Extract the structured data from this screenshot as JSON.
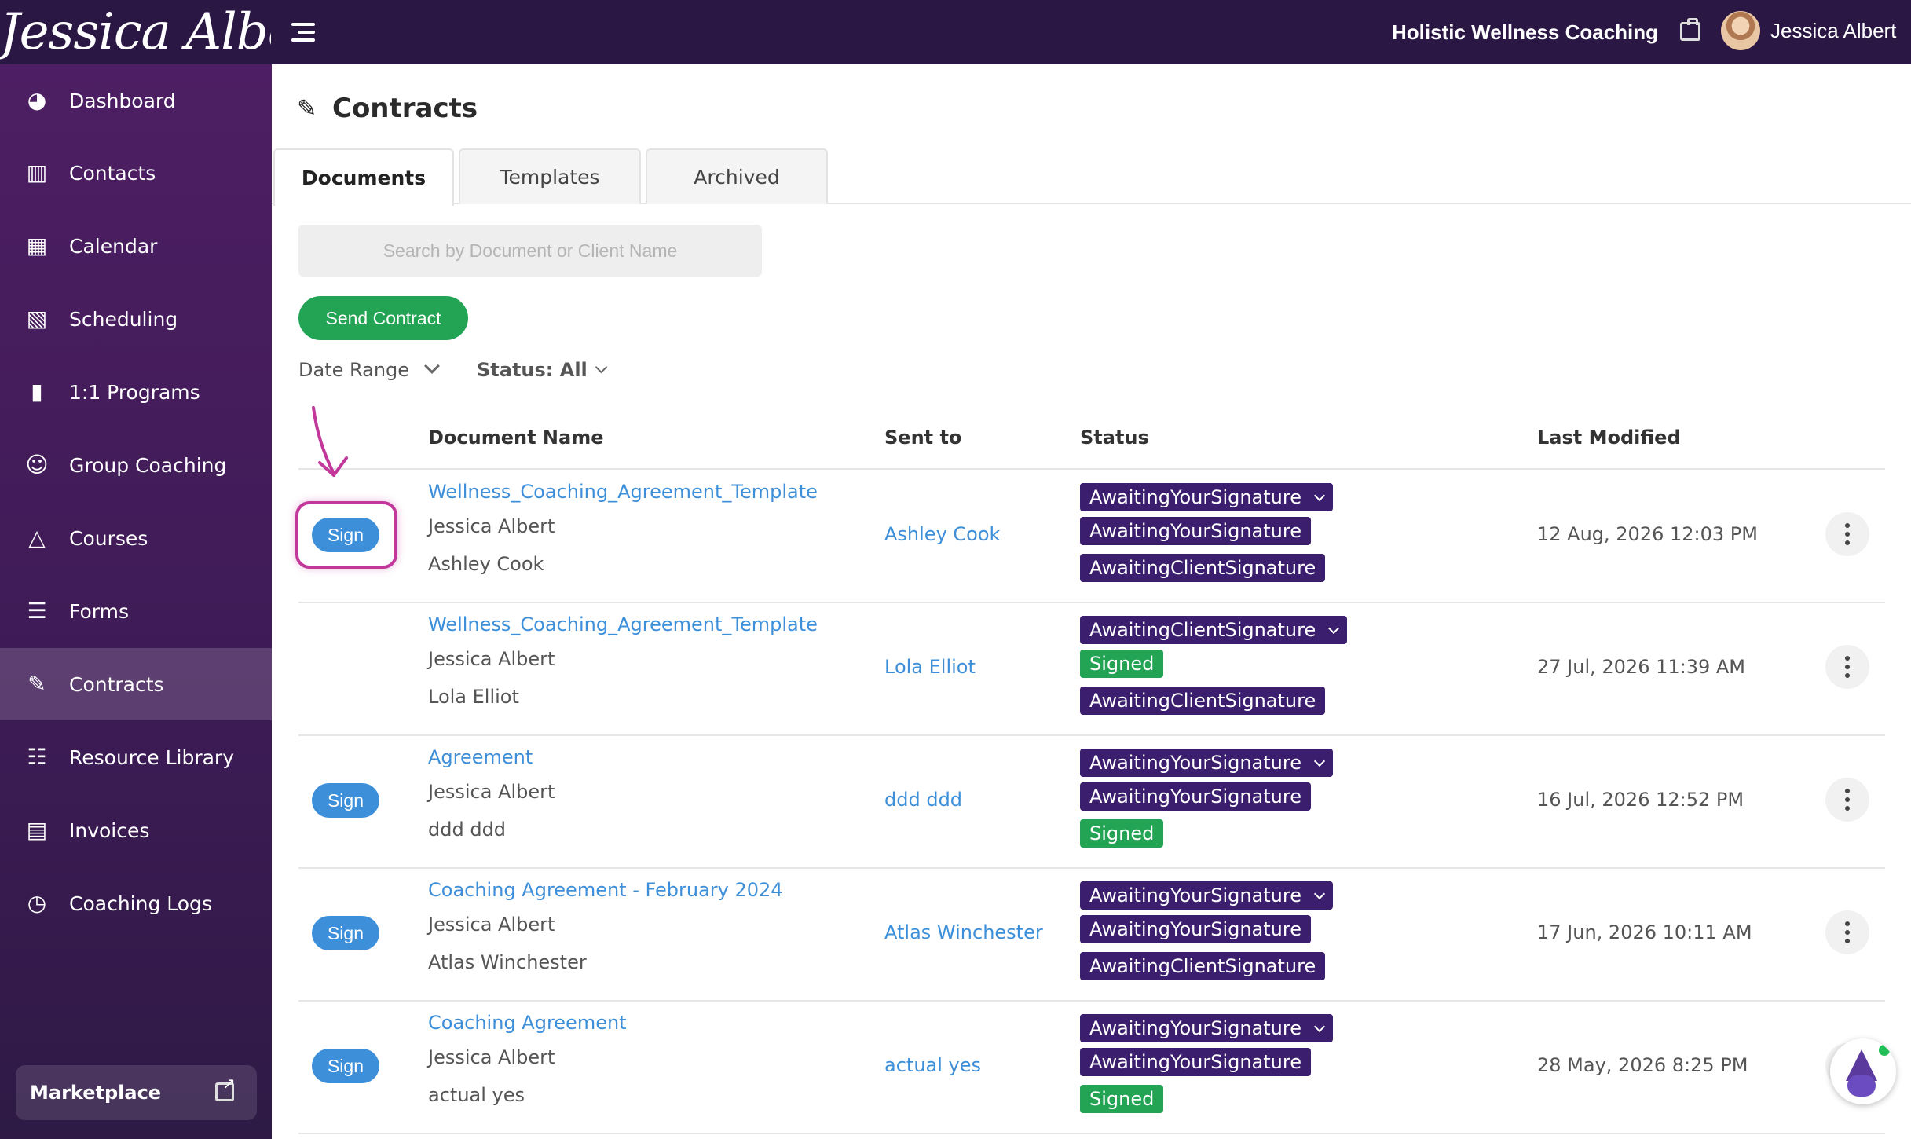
{
  "header": {
    "logo_text": "Jessica Albert",
    "business_name": "Holistic Wellness Coaching",
    "user_name": "Jessica Albert"
  },
  "sidebar": {
    "items": [
      {
        "label": "Dashboard",
        "icon": "dashboard-icon"
      },
      {
        "label": "Contacts",
        "icon": "contacts-icon"
      },
      {
        "label": "Calendar",
        "icon": "calendar-icon"
      },
      {
        "label": "Scheduling",
        "icon": "scheduling-icon"
      },
      {
        "label": "1:1 Programs",
        "icon": "book-icon"
      },
      {
        "label": "Group Coaching",
        "icon": "group-icon"
      },
      {
        "label": "Courses",
        "icon": "graduation-cap-icon"
      },
      {
        "label": "Forms",
        "icon": "list-check-icon"
      },
      {
        "label": "Contracts",
        "icon": "signature-icon",
        "active": true
      },
      {
        "label": "Resource Library",
        "icon": "books-icon"
      },
      {
        "label": "Invoices",
        "icon": "invoice-icon"
      },
      {
        "label": "Coaching Logs",
        "icon": "clock-icon"
      }
    ],
    "marketplace_label": "Marketplace"
  },
  "page": {
    "title": "Contracts",
    "tabs": [
      {
        "label": "Documents",
        "active": true
      },
      {
        "label": "Templates"
      },
      {
        "label": "Archived"
      }
    ],
    "search_placeholder": "Search by Document or Client Name",
    "send_button": "Send Contract",
    "filters": {
      "date_range": "Date Range",
      "status": "Status: All"
    }
  },
  "table": {
    "headers": {
      "document_name": "Document Name",
      "sent_to": "Sent to",
      "status": "Status",
      "last_modified": "Last Modified"
    },
    "sign_label": "Sign",
    "rows": [
      {
        "has_sign": true,
        "document": "Wellness_Coaching_Agreement_Template",
        "sender": "Jessica Albert",
        "recipient": "Ashley Cook",
        "sent_to": "Ashley Cook",
        "statuses": [
          "AwaitingYourSignature",
          "AwaitingYourSignature",
          "AwaitingClientSignature"
        ],
        "modified": "12 Aug, 2026 12:03 PM"
      },
      {
        "has_sign": false,
        "document": "Wellness_Coaching_Agreement_Template",
        "sender": "Jessica Albert",
        "recipient": "Lola Elliot",
        "sent_to": "Lola Elliot",
        "statuses": [
          "AwaitingClientSignature",
          "Signed",
          "AwaitingClientSignature"
        ],
        "modified": "27 Jul, 2026 11:39 AM"
      },
      {
        "has_sign": true,
        "document": "Agreement",
        "sender": "Jessica Albert",
        "recipient": "ddd ddd",
        "sent_to": "ddd ddd",
        "statuses": [
          "AwaitingYourSignature",
          "AwaitingYourSignature",
          "Signed"
        ],
        "modified": "16 Jul, 2026 12:52 PM"
      },
      {
        "has_sign": true,
        "document": "Coaching Agreement - February 2024",
        "sender": "Jessica Albert",
        "recipient": "Atlas Winchester",
        "sent_to": "Atlas Winchester",
        "statuses": [
          "AwaitingYourSignature",
          "AwaitingYourSignature",
          "AwaitingClientSignature"
        ],
        "modified": "17 Jun, 2026 10:11 AM"
      },
      {
        "has_sign": true,
        "document": "Coaching Agreement",
        "sender": "Jessica Albert",
        "recipient": "actual yes",
        "sent_to": "actual yes",
        "statuses": [
          "AwaitingYourSignature",
          "AwaitingYourSignature",
          "Signed"
        ],
        "modified": "28 May, 2026 8:25 PM"
      }
    ]
  },
  "colors": {
    "topbar": "#2a1744",
    "sidebar": "#4d1e63",
    "link_blue": "#3d8fd9",
    "awaiting_badge": "#3b1f6e",
    "signed_badge": "#23a455",
    "send_button": "#23a455",
    "annotation": "#c1379a"
  }
}
